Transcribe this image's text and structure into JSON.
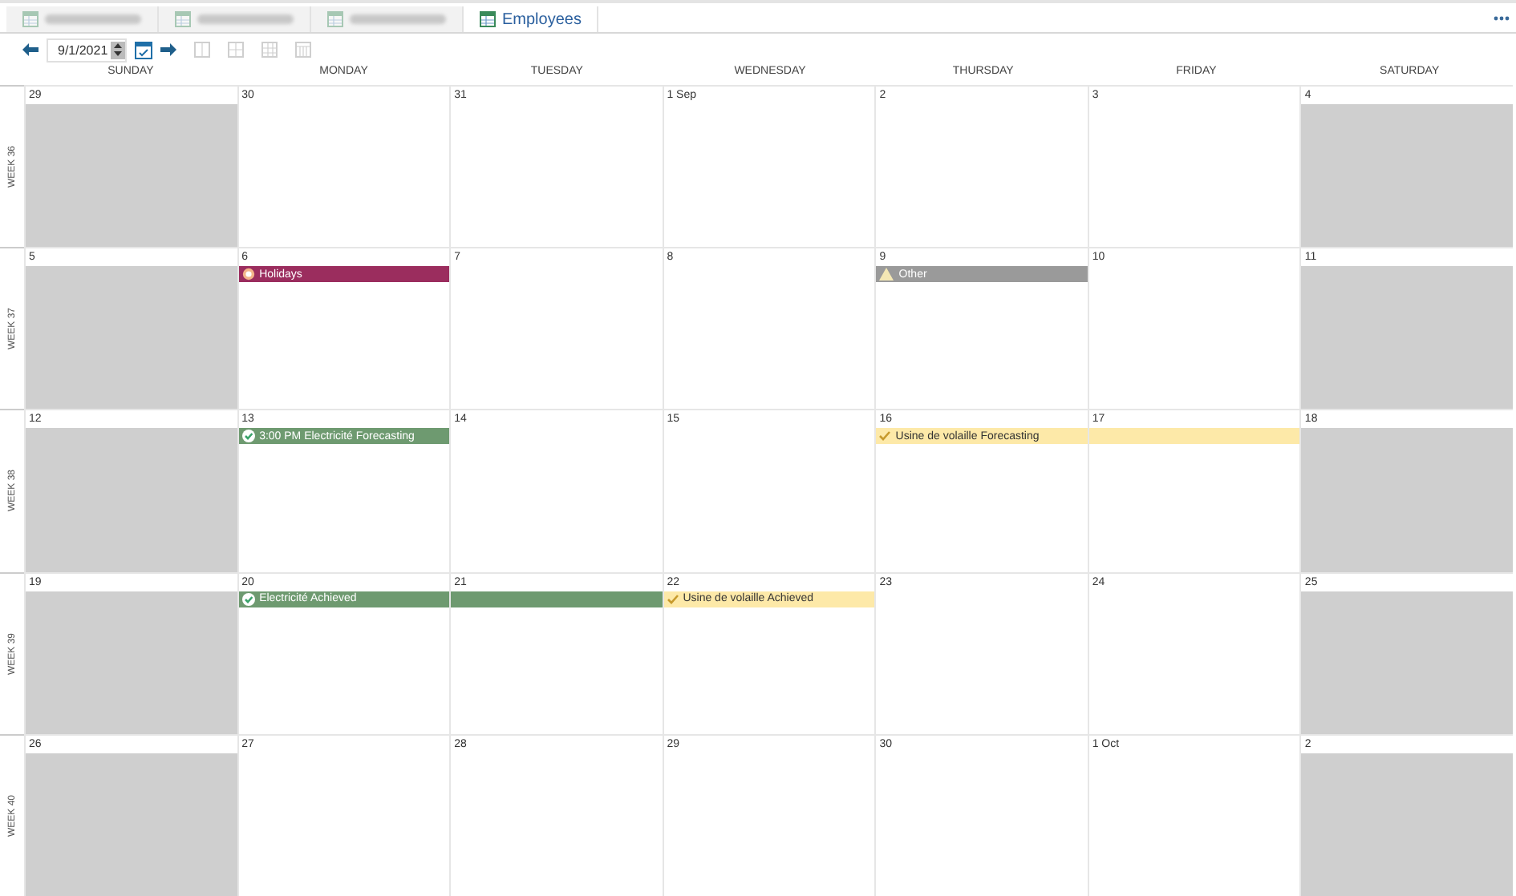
{
  "tabs": [
    {
      "kind": "blurred",
      "selected": false
    },
    {
      "kind": "blurred",
      "selected": false
    },
    {
      "kind": "blurred",
      "selected": false
    },
    {
      "kind": "named",
      "label": "Employees",
      "selected": true
    }
  ],
  "toolbar": {
    "date": "9/1/2021",
    "view_buttons": [
      {
        "disabled": true
      },
      {
        "disabled": true
      },
      {
        "disabled": true
      },
      {
        "disabled": true
      }
    ]
  },
  "day_headers": [
    "SUNDAY",
    "MONDAY",
    "TUESDAY",
    "WEDNESDAY",
    "THURSDAY",
    "FRIDAY",
    "SATURDAY"
  ],
  "weeks": [
    {
      "label": "WEEK 36",
      "days": [
        {
          "date": "29",
          "weekend": true
        },
        {
          "date": "30",
          "weekend": false
        },
        {
          "date": "31",
          "weekend": false
        },
        {
          "date": "1 Sep",
          "weekend": false
        },
        {
          "date": "2",
          "weekend": false
        },
        {
          "date": "3",
          "weekend": false
        },
        {
          "date": "4",
          "weekend": true
        }
      ]
    },
    {
      "label": "WEEK 37",
      "days": [
        {
          "date": "5",
          "weekend": true
        },
        {
          "date": "6",
          "weekend": false,
          "event": {
            "kind": "holiday",
            "title": "Holidays",
            "color": "#9b2d5e"
          }
        },
        {
          "date": "7",
          "weekend": false
        },
        {
          "date": "8",
          "weekend": false
        },
        {
          "date": "9",
          "weekend": false,
          "event": {
            "kind": "warning",
            "title": "Other",
            "color": "#9a9a9a"
          }
        },
        {
          "date": "10",
          "weekend": false
        },
        {
          "date": "11",
          "weekend": true
        }
      ]
    },
    {
      "label": "WEEK 38",
      "days": [
        {
          "date": "12",
          "weekend": true
        },
        {
          "date": "13",
          "weekend": false,
          "event": {
            "kind": "done",
            "title": "3:00 PM Electricité Forecasting",
            "color": "#6e9a70"
          }
        },
        {
          "date": "14",
          "weekend": false
        },
        {
          "date": "15",
          "weekend": false
        },
        {
          "date": "16",
          "weekend": false,
          "event": {
            "kind": "tick",
            "title": "Usine de volaille Forecasting",
            "color": "#fde9a8"
          }
        },
        {
          "date": "17",
          "weekend": false,
          "event": {
            "kind": "continued",
            "color": "#fde9a8"
          }
        },
        {
          "date": "18",
          "weekend": true
        }
      ]
    },
    {
      "label": "WEEK 39",
      "days": [
        {
          "date": "19",
          "weekend": true
        },
        {
          "date": "20",
          "weekend": false,
          "event": {
            "kind": "done",
            "title": "Electricité Achieved",
            "color": "#6e9a70"
          }
        },
        {
          "date": "21",
          "weekend": false,
          "event": {
            "kind": "continued",
            "color": "#6e9a70"
          }
        },
        {
          "date": "22",
          "weekend": false,
          "event": {
            "kind": "tick",
            "title": "Usine de volaille Achieved",
            "color": "#fde9a8"
          }
        },
        {
          "date": "23",
          "weekend": false
        },
        {
          "date": "24",
          "weekend": false
        },
        {
          "date": "25",
          "weekend": true
        }
      ]
    },
    {
      "label": "WEEK 40",
      "days": [
        {
          "date": "26",
          "weekend": true
        },
        {
          "date": "27",
          "weekend": false
        },
        {
          "date": "28",
          "weekend": false
        },
        {
          "date": "29",
          "weekend": false
        },
        {
          "date": "30",
          "weekend": false
        },
        {
          "date": "1 Oct",
          "weekend": false
        },
        {
          "date": "2",
          "weekend": true
        }
      ]
    }
  ]
}
